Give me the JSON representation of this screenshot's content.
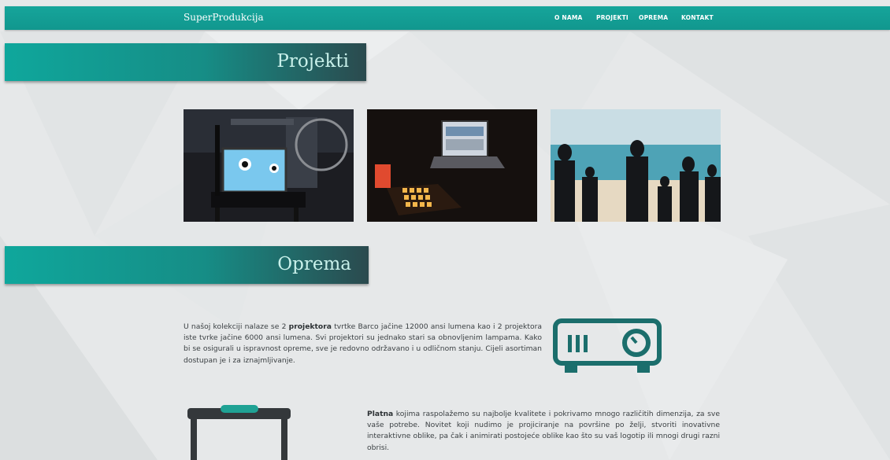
{
  "nav": {
    "brand": "SuperProdukcija",
    "items": [
      "O NAMA",
      "PROJEKTI",
      "OPREMA",
      "KONTAKT"
    ]
  },
  "sections": {
    "projects_title": "Projekti",
    "equipment_title": "Oprema"
  },
  "photos": [
    {
      "icon": "laptop-on-chair-photo"
    },
    {
      "icon": "dj-controller-photo"
    },
    {
      "icon": "people-at-beach-projection-photo"
    }
  ],
  "equipment": {
    "projector_text": {
      "pre": "U našoj kolekciji nalaze se 2 ",
      "bold": "projektora",
      "post": " tvrtke Barco jačine 12000 ansi lumena kao i 2 projektora iste tvrke jačine 6000 ansi lumena. Svi projektori su jednako stari sa obnovljenim lampama. Kako bi se osigurali u ispravnost opreme, sve je redovno održavano i u odličnom stanju. Cijeli asortiman dostupan je i za iznajmljivanje."
    },
    "screen_text": {
      "bold": "Platna",
      "post": " kojima raspolažemo su najbolje kvalitete i pokrivamo mnogo različitih dimenzija, za sve vaše potrebe. Novitet koji nudimo je projiciranje na površine po želji, stvoriti inovativne interaktivne oblike, pa čak i animirati postojeće oblike kao što su vaš logotip ili mnogi drugi razni obrisi."
    }
  },
  "colors": {
    "accent": "#14a096",
    "icon": "#1b6e6c",
    "background": "#e6e8e9"
  }
}
